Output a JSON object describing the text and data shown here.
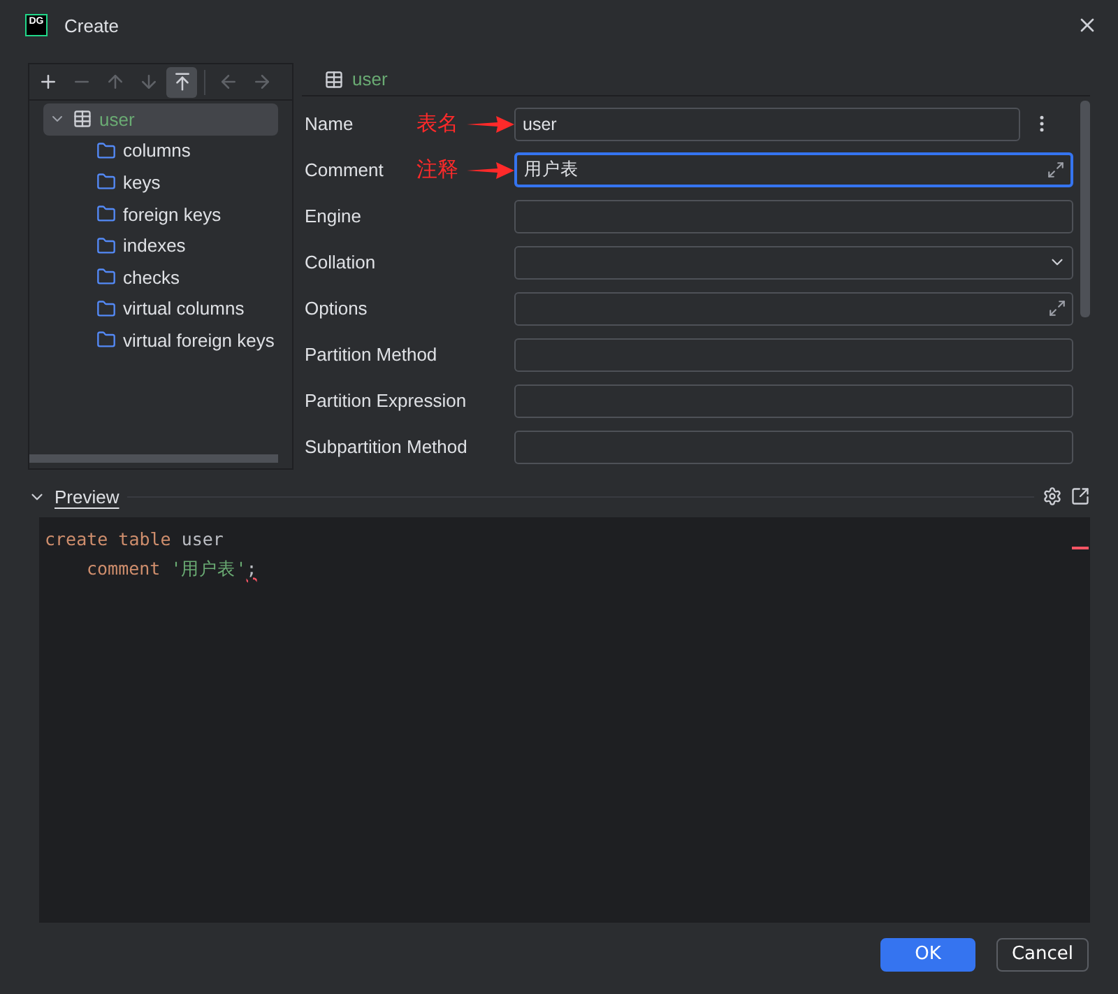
{
  "window": {
    "logo": "DG",
    "title": "Create"
  },
  "toolbar": [
    {
      "disabled": false,
      "selected": false
    },
    {
      "disabled": true,
      "selected": false
    },
    {
      "disabled": true,
      "selected": false
    },
    {
      "disabled": true,
      "selected": false
    },
    {
      "disabled": false,
      "selected": true
    },
    {
      "disabled": true,
      "selected": false
    },
    {
      "disabled": true,
      "selected": false
    }
  ],
  "tree": [
    {
      "label": "user",
      "kind": "table",
      "selected": true,
      "expanded": true,
      "children": [
        {
          "label": "columns",
          "kind": "folder",
          "selected": false
        },
        {
          "label": "keys",
          "kind": "folder",
          "selected": false
        },
        {
          "label": "foreign keys",
          "kind": "folder",
          "selected": false
        },
        {
          "label": "indexes",
          "kind": "folder",
          "selected": false
        },
        {
          "label": "checks",
          "kind": "folder",
          "selected": false
        },
        {
          "label": "virtual columns",
          "kind": "folder",
          "selected": false
        },
        {
          "label": "virtual foreign keys",
          "kind": "folder",
          "selected": false
        }
      ]
    }
  ],
  "header": {
    "label": "user"
  },
  "form": [
    {
      "label": "Name",
      "kind": "text",
      "value": "user",
      "annotation": "表名",
      "focused": false,
      "menu": true
    },
    {
      "label": "Comment",
      "kind": "expand",
      "value": "用户表",
      "annotation": "注释",
      "focused": true,
      "menu": false
    },
    {
      "label": "Engine",
      "kind": "text",
      "focused": false,
      "menu": false
    },
    {
      "label": "Collation",
      "kind": "select",
      "focused": false,
      "menu": false
    },
    {
      "label": "Options",
      "kind": "expand",
      "focused": false,
      "menu": false
    },
    {
      "label": "Partition Method",
      "kind": "text",
      "focused": false,
      "menu": false
    },
    {
      "label": "Partition Expression",
      "kind": "text",
      "focused": false,
      "menu": false
    },
    {
      "label": "Subpartition Method",
      "kind": "text",
      "focused": false,
      "menu": false
    }
  ],
  "preview": {
    "title": "Preview",
    "expanded": true,
    "code": [
      [
        {
          "kind": "keyword",
          "text": "create table "
        },
        {
          "kind": "plain",
          "text": "user"
        }
      ],
      [
        {
          "kind": "keyword",
          "text": "comment ",
          "indent": true
        },
        {
          "kind": "string",
          "text": "'用户表'"
        },
        {
          "kind": "error",
          "text": ";"
        }
      ]
    ]
  },
  "buttons": [
    {
      "label": "OK",
      "kind": "primary"
    },
    {
      "label": "Cancel",
      "kind": "secondary"
    }
  ]
}
